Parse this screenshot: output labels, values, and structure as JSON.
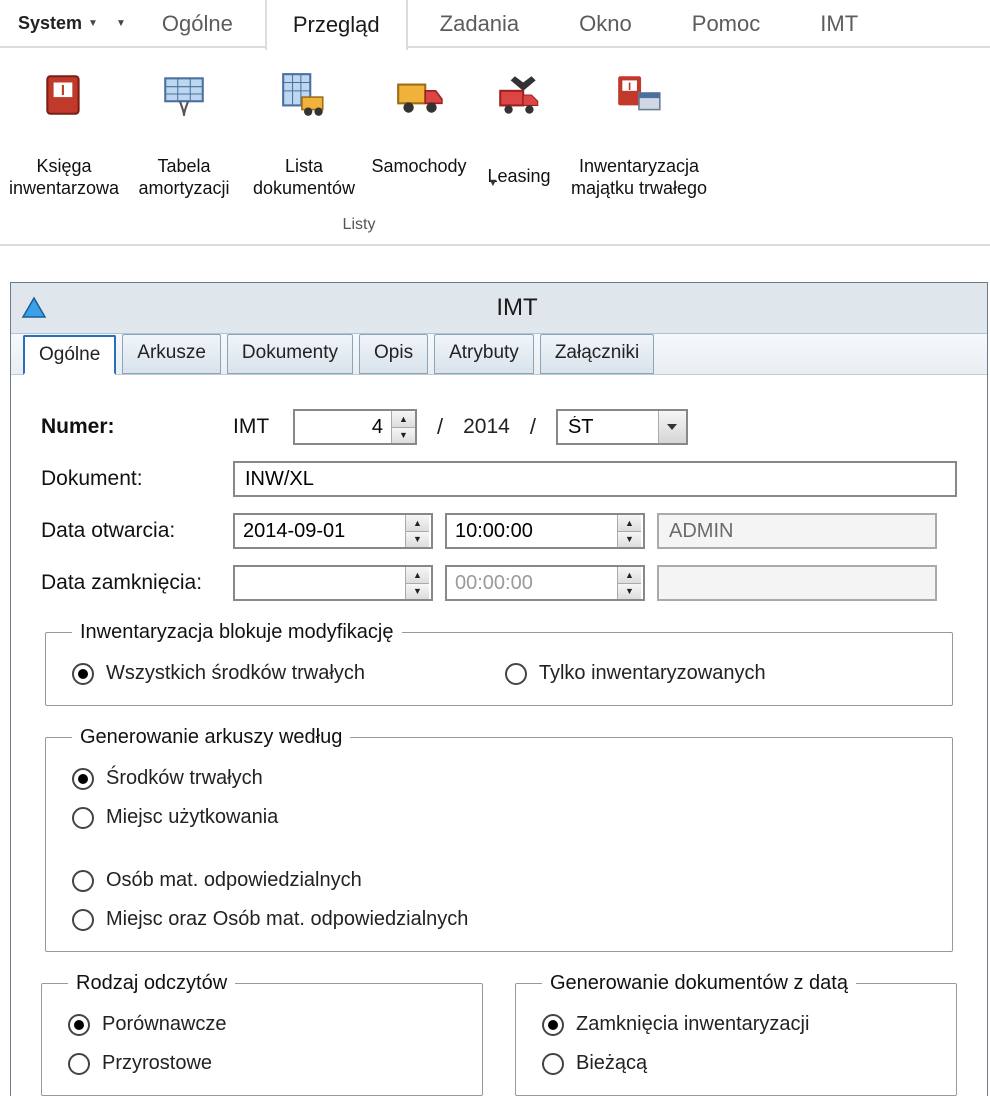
{
  "menubar": {
    "system": "System",
    "items": [
      "Ogólne",
      "Przegląd",
      "Zadania",
      "Okno",
      "Pomoc",
      "IMT"
    ],
    "active_index": 1
  },
  "ribbon": {
    "group_label": "Listy",
    "buttons": [
      {
        "label": "Księga inwentarzowa"
      },
      {
        "label": "Tabela amortyzacji"
      },
      {
        "label": "Lista dokumentów"
      },
      {
        "label": "Samochody"
      },
      {
        "label": "Leasing"
      },
      {
        "label": "Inwentaryzacja majątku trwałego"
      }
    ]
  },
  "window": {
    "title": "IMT",
    "tabs": [
      "Ogólne",
      "Arkusze",
      "Dokumenty",
      "Opis",
      "Atrybuty",
      "Załączniki"
    ],
    "active_tab_index": 0
  },
  "form": {
    "numer_label": "Numer:",
    "numer_prefix": "IMT",
    "numer_value": "4",
    "numer_year": "2014",
    "numer_type": "ŚT",
    "dokument_label": "Dokument:",
    "dokument_value": "INW/XL",
    "data_otwarcia_label": "Data otwarcia:",
    "data_otwarcia_date": "2014-09-01",
    "data_otwarcia_time": "10:00:00",
    "data_otwarcia_user": "ADMIN",
    "data_zamkniecia_label": "Data zamknięcia:",
    "data_zamkniecia_date": "",
    "data_zamkniecia_time": "00:00:00",
    "data_zamkniecia_user": ""
  },
  "groups": {
    "blokuje": {
      "legend": "Inwentaryzacja blokuje modyfikację",
      "options": [
        "Wszystkich środków trwałych",
        "Tylko inwentaryzowanych"
      ],
      "selected": 0
    },
    "arkuszy": {
      "legend": "Generowanie arkuszy według",
      "options": [
        "Środków trwałych",
        "Miejsc użytkowania",
        "Osób mat. odpowiedzialnych",
        "Miejsc oraz Osób mat. odpowiedzialnych"
      ],
      "selected": 0
    },
    "odczyty": {
      "legend": "Rodzaj odczytów",
      "options": [
        "Porównawcze",
        "Przyrostowe"
      ],
      "selected": 0
    },
    "dokumenty": {
      "legend": "Generowanie dokumentów z datą",
      "options": [
        "Zamknięcia inwentaryzacji",
        "Bieżącą"
      ],
      "selected": 0
    }
  }
}
